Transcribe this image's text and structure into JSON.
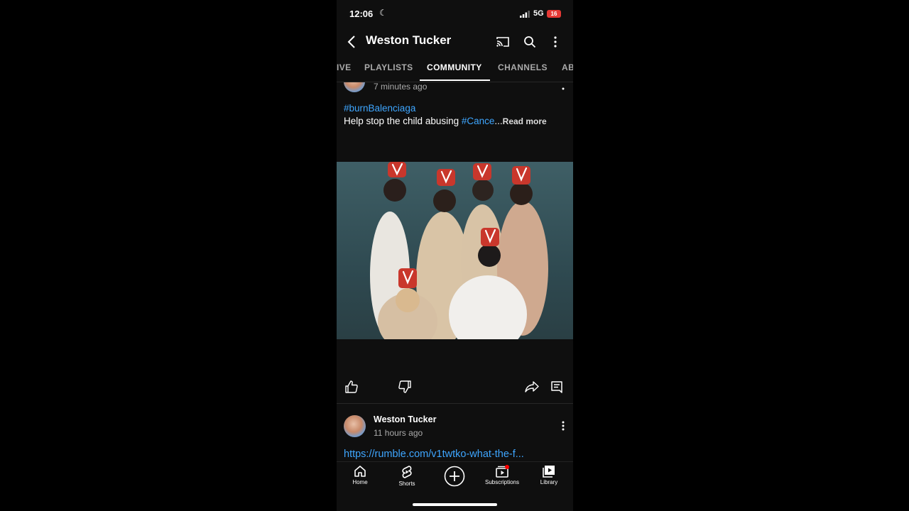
{
  "status_bar": {
    "time": "12:06",
    "network": "5G",
    "battery": "16"
  },
  "header": {
    "title": "Weston Tucker"
  },
  "tabs": [
    {
      "label": "IVE"
    },
    {
      "label": "PLAYLISTS"
    },
    {
      "label": "COMMUNITY",
      "active": true
    },
    {
      "label": "CHANNELS"
    },
    {
      "label": "AB"
    }
  ],
  "post1": {
    "time": "7 minutes ago",
    "hashtag": "#burnBalenciaga",
    "text": "Help stop the child abusing ",
    "trailing_tag": "#Cance",
    "ellipsis": "...",
    "read_more": "Read more"
  },
  "post2": {
    "author": "Weston Tucker",
    "time": "11 hours ago",
    "link": "https://rumble.com/v1twtko-what-the-f..."
  },
  "bottom_nav": {
    "home": "Home",
    "shorts": "Shorts",
    "subscriptions": "Subscriptions",
    "library": "Library"
  },
  "colors": {
    "accent_link": "#3ea6ff",
    "background": "#0f0f0f",
    "notification": "#ff0000"
  }
}
